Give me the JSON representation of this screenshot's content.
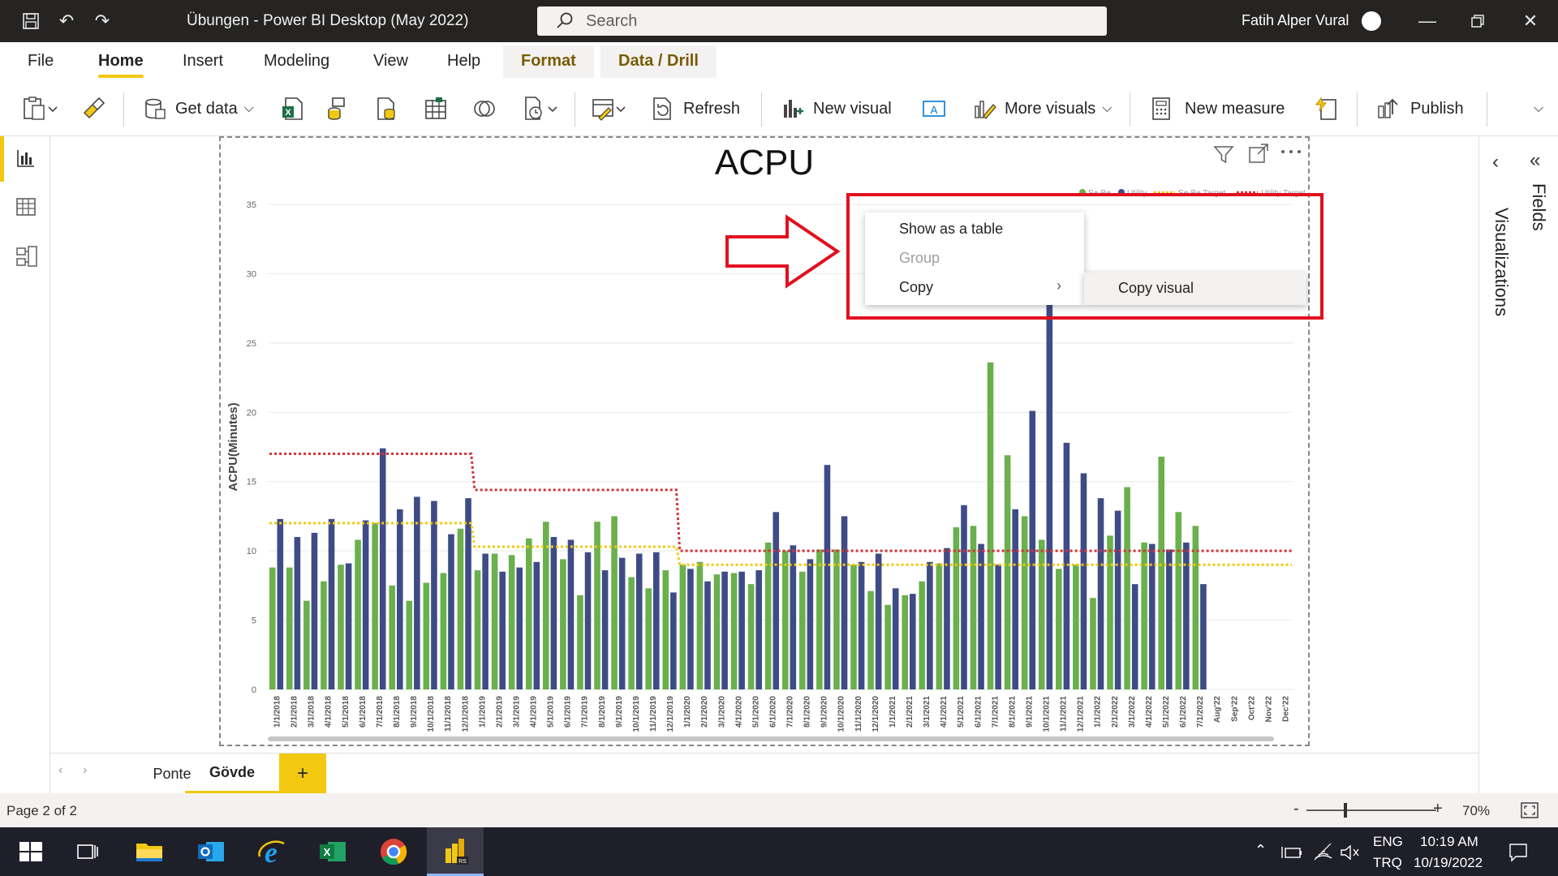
{
  "app": {
    "title": "Übungen - Power BI Desktop (May 2022)",
    "search_placeholder": "Search",
    "user": "Fatih Alper Vural"
  },
  "ribbon_tabs": [
    "File",
    "Home",
    "Insert",
    "Modeling",
    "View",
    "Help",
    "Format",
    "Data / Drill"
  ],
  "ribbon": {
    "get_data": "Get data",
    "refresh": "Refresh",
    "new_visual": "New visual",
    "more_visuals": "More visuals",
    "new_measure": "New measure",
    "publish": "Publish"
  },
  "side_panes": {
    "visualizations": "Visualizations",
    "fields": "Fields"
  },
  "context_menu": {
    "show_as_table": "Show as a table",
    "group": "Group",
    "copy": "Copy",
    "copy_visual": "Copy visual"
  },
  "page_tabs": [
    "Ponte",
    "Gövde"
  ],
  "status": {
    "page": "Page 2 of 2",
    "zoom": "70%"
  },
  "taskbar": {
    "lang1": "ENG",
    "lang2": "TRQ",
    "time": "10:19 AM",
    "date": "10/19/2022"
  },
  "colors": {
    "accent": "#f2c811",
    "green_bar": "#6ab04c",
    "blue_bar": "#3f4b86",
    "red_target": "#d13438",
    "yellow_target": "#f2c811",
    "annotation_red": "#e2101e"
  },
  "chart_data": {
    "type": "bar",
    "title": "ACPU",
    "ylabel": "ACPU(Minutes)",
    "ylim": [
      0,
      35
    ],
    "yticks": [
      0,
      5,
      10,
      15,
      20,
      25,
      30,
      35
    ],
    "legend": [
      "Se-Be",
      "Utility",
      "Se-Be Target",
      "Utility Target"
    ],
    "categories": [
      "1/1/2018",
      "2/1/2018",
      "3/1/2018",
      "4/1/2018",
      "5/1/2018",
      "6/1/2018",
      "7/1/2018",
      "8/1/2018",
      "9/1/2018",
      "10/1/2018",
      "11/1/2018",
      "12/1/2018",
      "1/1/2019",
      "2/1/2019",
      "3/1/2019",
      "4/1/2019",
      "5/1/2019",
      "6/1/2019",
      "7/1/2019",
      "8/1/2019",
      "9/1/2019",
      "10/1/2019",
      "11/1/2019",
      "12/1/2019",
      "1/1/2020",
      "2/1/2020",
      "3/1/2020",
      "4/1/2020",
      "5/1/2020",
      "6/1/2020",
      "7/1/2020",
      "8/1/2020",
      "9/1/2020",
      "10/1/2020",
      "11/1/2020",
      "12/1/2020",
      "1/1/2021",
      "2/1/2021",
      "3/1/2021",
      "4/1/2021",
      "5/1/2021",
      "6/1/2021",
      "7/1/2021",
      "8/1/2021",
      "9/1/2021",
      "10/1/2021",
      "11/1/2021",
      "12/1/2021",
      "1/1/2022",
      "2/1/2022",
      "3/1/2022",
      "4/1/2022",
      "5/1/2022",
      "6/1/2022",
      "7/1/2022",
      "Aug'22",
      "Sep'22",
      "Oct'22",
      "Nov'22",
      "Dec'22"
    ],
    "series": [
      {
        "name": "Se-Be",
        "values": [
          8.8,
          8.8,
          6.4,
          7.8,
          9.0,
          10.8,
          12.0,
          7.5,
          6.4,
          7.7,
          8.4,
          11.6,
          8.6,
          9.8,
          9.7,
          10.9,
          12.1,
          9.4,
          6.8,
          12.1,
          12.5,
          8.1,
          7.3,
          8.6,
          9.0,
          9.2,
          8.3,
          8.4,
          7.6,
          10.6,
          10.0,
          8.5,
          10.1,
          10.1,
          9.0,
          7.1,
          6.1,
          6.8,
          7.8,
          9.1,
          11.7,
          11.8,
          23.6,
          16.9,
          12.5,
          10.8,
          8.7,
          9.0,
          6.6,
          11.1,
          14.6,
          10.6,
          16.8,
          12.8,
          11.8,
          null,
          null,
          null,
          null,
          null
        ]
      },
      {
        "name": "Utility",
        "values": [
          12.3,
          11.0,
          11.3,
          12.3,
          9.1,
          12.2,
          17.4,
          13.0,
          13.9,
          13.6,
          11.2,
          13.8,
          9.8,
          8.5,
          8.8,
          9.2,
          11.0,
          10.8,
          9.9,
          8.6,
          9.5,
          9.8,
          9.9,
          7.0,
          8.7,
          7.8,
          8.5,
          8.5,
          8.6,
          12.8,
          10.4,
          9.4,
          16.2,
          12.5,
          9.2,
          9.8,
          7.3,
          6.9,
          9.2,
          10.2,
          13.3,
          10.5,
          9.0,
          13.0,
          20.1,
          28.5,
          17.8,
          15.6,
          13.8,
          12.9,
          7.6,
          10.5,
          10.1,
          10.6,
          7.6,
          null,
          null,
          null,
          null,
          null
        ]
      }
    ],
    "targets": {
      "Utility Target": [
        17,
        17,
        17,
        17,
        17,
        17,
        17,
        17,
        17,
        17,
        17,
        17,
        14.4,
        14.4,
        14.4,
        14.4,
        14.4,
        14.4,
        14.4,
        14.4,
        14.4,
        14.4,
        14.4,
        14.4,
        10,
        10,
        10,
        10,
        10,
        10,
        10,
        10,
        10,
        10,
        10,
        10,
        10,
        10,
        10,
        10,
        10,
        10,
        10,
        10,
        10,
        10,
        10,
        10,
        10,
        10,
        10,
        10,
        10,
        10,
        10,
        10,
        10,
        10,
        10,
        10
      ],
      "Se-Be Target": [
        12,
        12,
        12,
        12,
        12,
        12,
        12,
        12,
        12,
        12,
        12,
        12,
        10.3,
        10.3,
        10.3,
        10.3,
        10.3,
        10.3,
        10.3,
        10.3,
        10.3,
        10.3,
        10.3,
        10.3,
        9,
        9,
        9,
        9,
        9,
        9,
        9,
        9,
        9,
        9,
        9,
        9,
        9,
        9,
        9,
        9,
        9,
        9,
        9,
        9,
        9,
        9,
        9,
        9,
        9,
        9,
        9,
        9,
        9,
        9,
        9,
        9,
        9,
        9,
        9,
        9
      ]
    }
  }
}
